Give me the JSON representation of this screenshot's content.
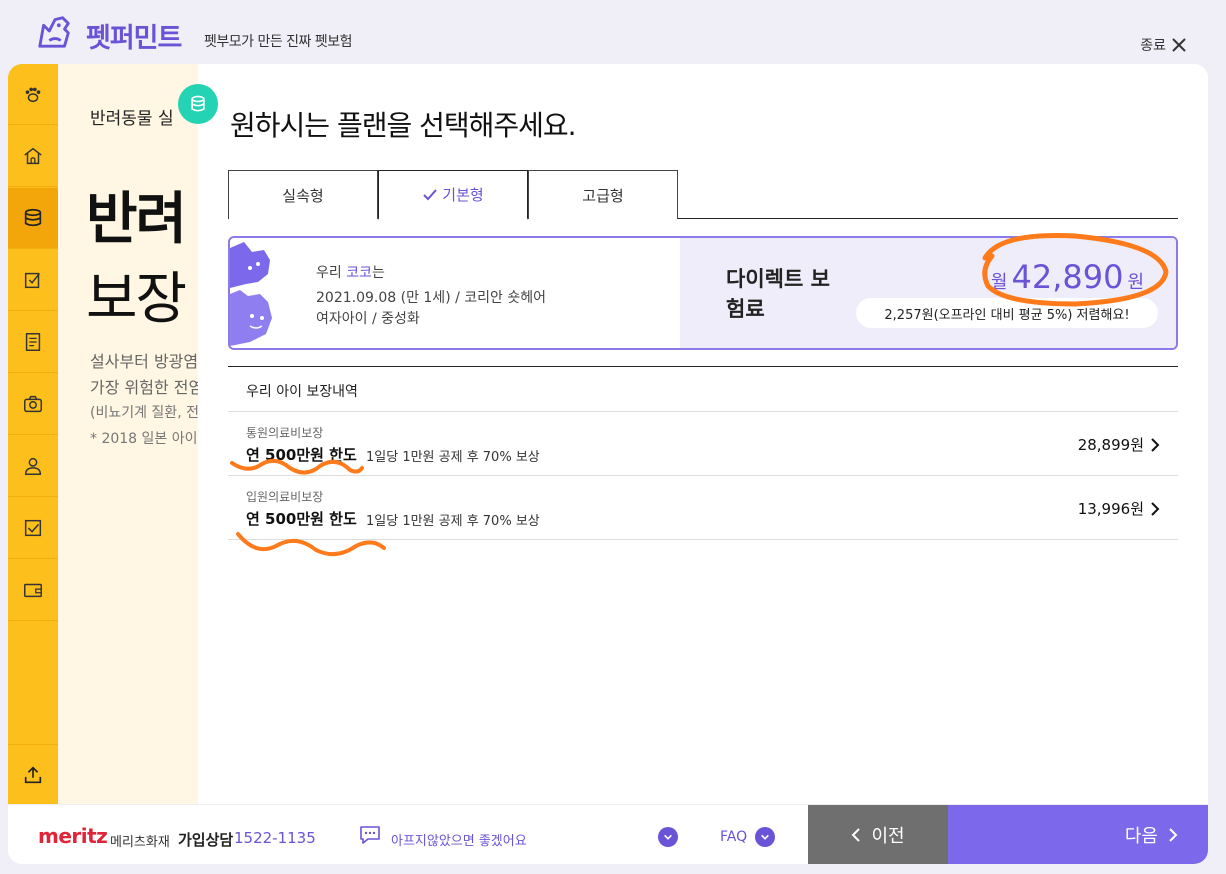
{
  "header": {
    "brand": "펫퍼민트",
    "tagline": "펫부모가 만든 진짜 펫보험",
    "close_label": "종료"
  },
  "background_intro": {
    "small": "반려동물 실",
    "big1": "반려",
    "big2": "보장",
    "desc1": "설사부터 방광염",
    "desc2": "가장 위험한 전염",
    "desc3": "(비뇨기계 질환, 전",
    "desc4": "* 2018 일본 아이"
  },
  "panel": {
    "title": "원하시는 플랜을 선택해주세요."
  },
  "tabs": [
    {
      "label": "실속형",
      "active": false
    },
    {
      "label": "기본형",
      "active": true
    },
    {
      "label": "고급형",
      "active": false
    }
  ],
  "pet": {
    "prefix": "우리 ",
    "name": "코코",
    "suffix": "는",
    "birth": "2021.09.08 (만 1세) / 코리안 숏헤어",
    "gender": "여자아이 / 중성화"
  },
  "premium": {
    "label": "다이렉트 보험료",
    "unit_prefix": "월",
    "amount": "42,890",
    "unit_suffix": "원",
    "discount": "2,257원(오프라인 대비 평균 5%) 저렴해요!"
  },
  "coverage": {
    "header": "우리 아이 보장내역",
    "rows": [
      {
        "category": "통원의료비보장",
        "limit": "연 500만원 한도",
        "detail": "1일당 1만원 공제 후 70% 보상",
        "amount": "28,899원"
      },
      {
        "category": "입원의료비보장",
        "limit": "연 500만원 한도",
        "detail": "1일당 1만원 공제 후 70% 보상",
        "amount": "13,996원"
      }
    ]
  },
  "footer": {
    "logo": "meritz",
    "logo_kr": "메리츠화재",
    "contact_label": "가입상담",
    "contact_number": "1522-1135",
    "chat_text": "아프지않았으면 좋겠어요",
    "faq": "FAQ",
    "prev": "이전",
    "next": "다음"
  },
  "colors": {
    "brand_purple": "#6a53d6",
    "sidebar_yellow": "#fdbf1c",
    "next_button": "#7b68ea",
    "prev_button": "#6f6f6f",
    "annotation_orange": "#ff7a1a"
  }
}
